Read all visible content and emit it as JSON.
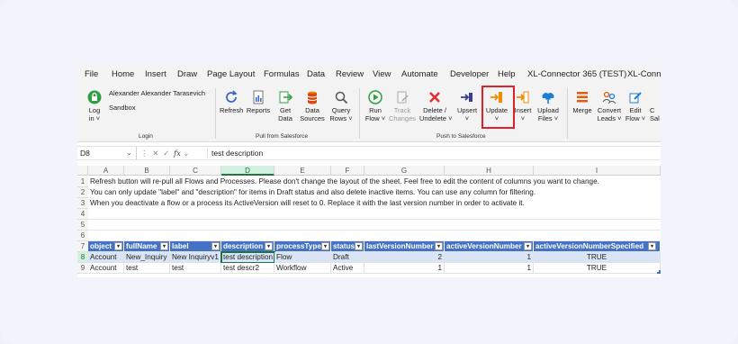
{
  "menu": {
    "items": [
      "File",
      "Home",
      "Insert",
      "Draw",
      "Page Layout",
      "Formulas",
      "Data",
      "Review",
      "View",
      "Automate",
      "Developer",
      "Help",
      "XL-Connector 365 (TEST)",
      "XL-Conne"
    ]
  },
  "ribbon": {
    "login": {
      "user": "Alexander Alexander Tarasevich",
      "env": "Sandbox",
      "label1": "Log",
      "label2": "in ˅",
      "group": "Login"
    },
    "pull": {
      "refresh": "Refresh",
      "reports": "Reports",
      "get1": "Get",
      "get2": "Data",
      "data1": "Data",
      "data2": "Sources",
      "query1": "Query",
      "query2": "Rows ˅",
      "group": "Pull from Salesforce"
    },
    "push": {
      "run1": "Run",
      "run2": "Flow ˅",
      "track1": "Track",
      "track2": "Changes",
      "delete1": "Delete /",
      "delete2": "Undelete ˅",
      "upsert1": "Upsert",
      "upsert2": "˅",
      "update1": "Update",
      "update2": "˅",
      "insert1": "Insert",
      "insert2": "˅",
      "upload1": "Upload",
      "upload2": "Files ˅",
      "group": "Push to Salesforce"
    },
    "more": {
      "merge": "Merge",
      "convert1": "Convert",
      "convert2": "Leads ˅",
      "edit1": "Edit",
      "edit2": "Flow ˅",
      "cut1": "C",
      "cut2": "Sal"
    }
  },
  "formula_bar": {
    "cell_ref": "D8",
    "fx": "fx",
    "value": "test description"
  },
  "columns": [
    "A",
    "B",
    "C",
    "D",
    "E",
    "F",
    "G",
    "H",
    "I"
  ],
  "rows": [
    "1",
    "2",
    "3",
    "4",
    "5",
    "6",
    "7",
    "8",
    "9"
  ],
  "notes": [
    "Refresh button will re-pull all Flows and Processes. Please don't change the layout of the sheet. Feel free to edit the content of columns you want to change.",
    "You can only update \"label\" and \"description\" for items in Draft status and also delete inactive items. You can use any column for filtering.",
    "When you deactivate a flow or a process its ActiveVersion will reset to 0. Replace it with the last version number in order to activate it."
  ],
  "table": {
    "headers": [
      "object",
      "fullName",
      "label",
      "description",
      "processType",
      "status",
      "lastVersionNumber",
      "activeVersionNumber",
      "activeVersionNumberSpecified"
    ],
    "rows": [
      [
        "Account",
        "New_Inquiry",
        "New Inquiryv1",
        "test description",
        "Flow",
        "Draft",
        "2",
        "1",
        "TRUE"
      ],
      [
        "Account",
        "test",
        "test",
        "test descr2",
        "Workflow",
        "Active",
        "1",
        "1",
        "TRUE"
      ]
    ]
  },
  "colors": {
    "table_header": "#4472c4",
    "highlight": "#e0202a",
    "selected": "#217346"
  }
}
